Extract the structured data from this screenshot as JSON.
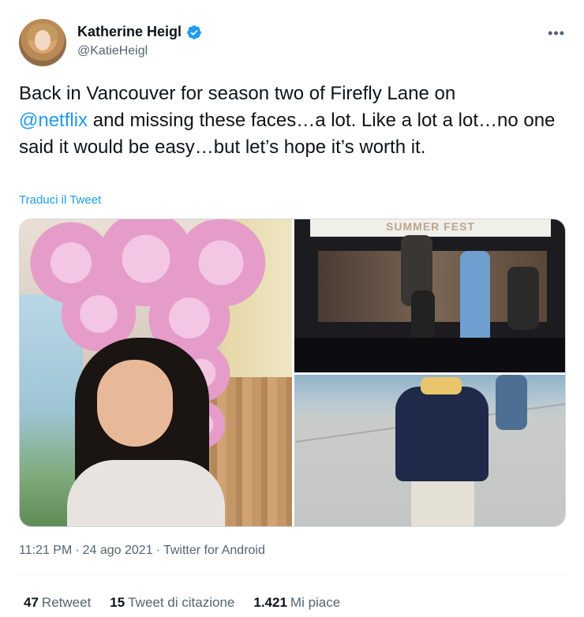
{
  "header": {
    "display_name": "Katherine Heigl",
    "handle": "@KatieHeigl",
    "more_label": "•••"
  },
  "tweet": {
    "line1": "Back in Vancouver for season two of Firefly Lane on",
    "mention": "@netflix",
    "line2_rest": " and missing these faces…a lot. Like a lot a lot…no one said it would be easy…but let’s hope it’s worth it."
  },
  "translate_link": "Traduci il Tweet",
  "media": {
    "stage_banner": "SUMMER FEST"
  },
  "meta": {
    "time": "11:21 PM",
    "date": "24 ago 2021",
    "source": "Twitter for Android",
    "separator": "·"
  },
  "stats": {
    "retweets_count": "47",
    "retweets_label": "Retweet",
    "quotes_count": "15",
    "quotes_label": "Tweet di citazione",
    "likes_count": "1.421",
    "likes_label": "Mi piace"
  },
  "colors": {
    "accent": "#1d9bf0",
    "secondary_text": "#536471",
    "primary_text": "#0f1419"
  }
}
